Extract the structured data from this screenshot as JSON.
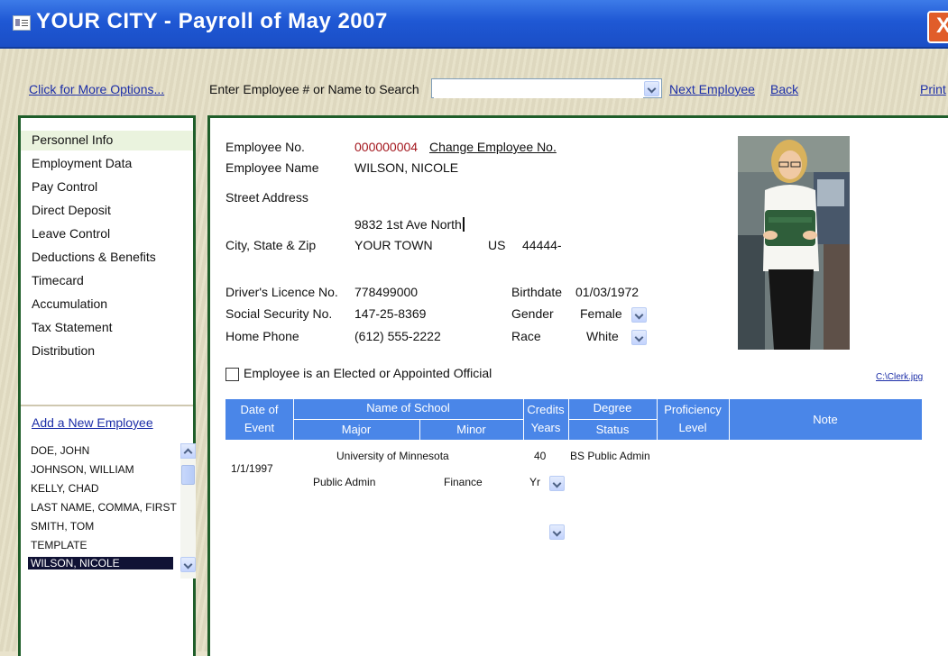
{
  "window": {
    "title": "YOUR CITY - Payroll of May 2007",
    "close_label": "X"
  },
  "toolbar": {
    "more_options": "Click for More Options...",
    "search_label": "Enter Employee # or Name to Search",
    "search_value": "",
    "next_employee": "Next Employee",
    "back": "Back",
    "print": "Print"
  },
  "nav": {
    "items": [
      {
        "label": "Personnel Info",
        "selected": true
      },
      {
        "label": "Employment Data"
      },
      {
        "label": "Pay Control"
      },
      {
        "label": "Direct Deposit"
      },
      {
        "label": "Leave Control"
      },
      {
        "label": "Deductions & Benefits"
      },
      {
        "label": "Timecard"
      },
      {
        "label": "Accumulation"
      },
      {
        "label": "Tax Statement"
      },
      {
        "label": "Distribution"
      }
    ],
    "add_employee": "Add a New Employee",
    "employees": [
      "DOE, JOHN",
      "JOHNSON, WILLIAM",
      "KELLY, CHAD",
      "LAST NAME, COMMA, FIRST",
      "SMITH, TOM",
      "TEMPLATE",
      "WILSON, NICOLE"
    ],
    "selected_employee": "WILSON, NICOLE"
  },
  "form": {
    "emp_no_label": "Employee No.",
    "emp_no": "000000004",
    "change_emp_no": "Change Employee No.",
    "emp_name_label": "Employee Name",
    "emp_name": "WILSON, NICOLE",
    "street_label": "Street Address",
    "street": "9832 1st Ave North",
    "city_label": "City, State & Zip",
    "city": "YOUR TOWN",
    "state": "US",
    "zip": "44444-",
    "license_label": "Driver's Licence No.",
    "license": "778499000",
    "ssn_label": "Social Security No.",
    "ssn": "147-25-8369",
    "phone_label": "Home Phone",
    "phone": "(612) 555-2222",
    "birthdate_label": "Birthdate",
    "birthdate": "01/03/1972",
    "gender_label": "Gender",
    "gender": "Female",
    "race_label": "Race",
    "race": "White",
    "elected_label": "Employee is an Elected or Appointed Official",
    "elected_checked": false,
    "photo_path": "C:\\Clerk.jpg"
  },
  "education": {
    "headers": {
      "date_of": "Date of",
      "event": "Event",
      "name_of_school": "Name of School",
      "major": "Major",
      "minor": "Minor",
      "credits": "Credits",
      "years": "Years",
      "degree": "Degree",
      "status": "Status",
      "proficiency": "Proficiency",
      "level": "Level",
      "note": "Note"
    },
    "rows": [
      {
        "date": "1/1/1997",
        "school": "University of Minnesota",
        "major": "Public Admin",
        "minor": "Finance",
        "credits": "40",
        "years_unit": "Yr",
        "degree": "BS Public Admin"
      }
    ]
  }
}
